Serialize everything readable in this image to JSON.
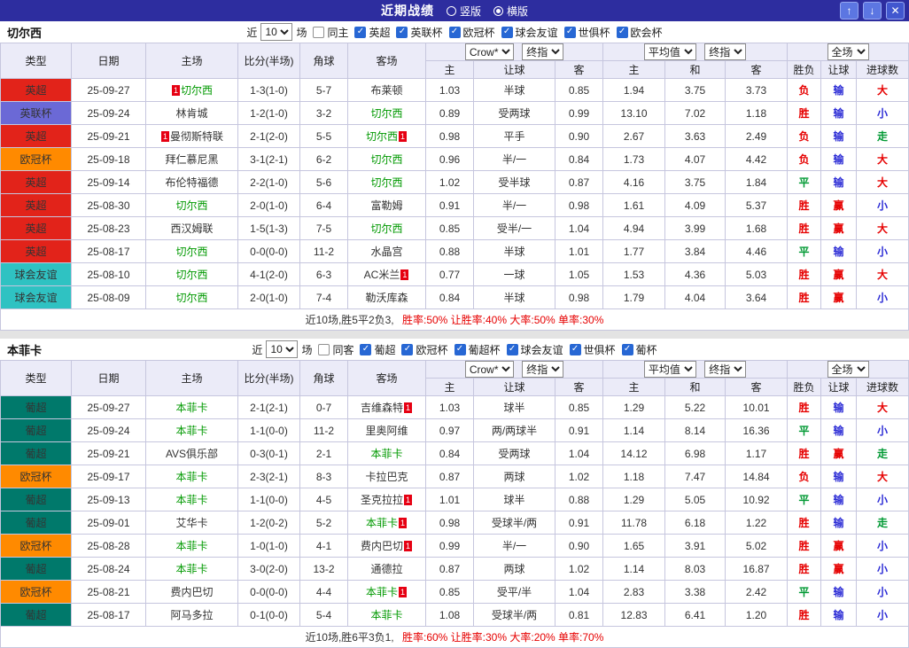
{
  "topbar": {
    "title": "近期战绩",
    "radios": [
      {
        "label": "竖版",
        "selected": false
      },
      {
        "label": "横版",
        "selected": true
      }
    ],
    "buttons": {
      "up": "↑",
      "down": "↓",
      "close": "✕"
    }
  },
  "table_header": {
    "cols": [
      "类型",
      "日期",
      "主场",
      "比分(半场)",
      "角球",
      "客场"
    ],
    "asia_selects": [
      "Crow*",
      "终指"
    ],
    "asia_cols": [
      "主",
      "让球",
      "客"
    ],
    "europe_selects": [
      "平均值",
      "终指"
    ],
    "europe_cols": [
      "主",
      "和",
      "客"
    ],
    "period_select": "全场",
    "result_cols": [
      "胜负",
      "让球",
      "进球数"
    ]
  },
  "league_colors": {
    "英超": "#e2231a",
    "英联杯": "#6b69d6",
    "欧冠杯": "#ff8a00",
    "球会友谊": "#2fc2c2",
    "葡超": "#00796b"
  },
  "result_colors": {
    "red": "#e60000",
    "blue": "#2b2bd5",
    "green": "#009933"
  },
  "colors": {
    "topbar_bg": "#2d2d9f",
    "header_bg": "#ebebf8",
    "focus_team": "#009900",
    "score": "#ff0000",
    "card_badge": "#e60012"
  },
  "sections": [
    {
      "team": "切尔西",
      "filter": {
        "near": "近",
        "count": "10",
        "unit": "场",
        "same": {
          "label": "同主",
          "checked": false
        },
        "leagues": [
          {
            "label": "英超",
            "checked": true
          },
          {
            "label": "英联杯",
            "checked": true
          },
          {
            "label": "欧冠杯",
            "checked": true
          },
          {
            "label": "球会友谊",
            "checked": true
          },
          {
            "label": "世俱杯",
            "checked": true
          },
          {
            "label": "欧会杯",
            "checked": true
          }
        ]
      },
      "rows": [
        {
          "league": "英超",
          "date": "25-09-27",
          "home": "切尔西",
          "home_focus": true,
          "home_card": {
            "pos": "before",
            "count": "1"
          },
          "score": "1-3(1-0)",
          "corners": "5-7",
          "away": "布莱顿",
          "odds": [
            "1.03",
            "半球",
            "0.85"
          ],
          "avg": [
            "1.94",
            "3.75",
            "3.73"
          ],
          "results": [
            [
              "负",
              "red"
            ],
            [
              "输",
              "blue"
            ],
            [
              "大",
              "red"
            ]
          ]
        },
        {
          "league": "英联杯",
          "date": "25-09-24",
          "home": "林肯城",
          "score": "1-2(1-0)",
          "corners": "3-2",
          "away": "切尔西",
          "away_focus": true,
          "odds": [
            "0.89",
            "受两球",
            "0.99"
          ],
          "avg": [
            "13.10",
            "7.02",
            "1.18"
          ],
          "results": [
            [
              "胜",
              "red"
            ],
            [
              "输",
              "blue"
            ],
            [
              "小",
              "blue"
            ]
          ]
        },
        {
          "league": "英超",
          "date": "25-09-21",
          "home": "曼彻斯特联",
          "home_card": {
            "pos": "before",
            "count": "1"
          },
          "score": "2-1(2-0)",
          "corners": "5-5",
          "away": "切尔西",
          "away_focus": true,
          "away_card": {
            "pos": "after",
            "count": "1"
          },
          "odds": [
            "0.98",
            "平手",
            "0.90"
          ],
          "avg": [
            "2.67",
            "3.63",
            "2.49"
          ],
          "results": [
            [
              "负",
              "red"
            ],
            [
              "输",
              "blue"
            ],
            [
              "走",
              "green"
            ]
          ]
        },
        {
          "league": "欧冠杯",
          "date": "25-09-18",
          "home": "拜仁慕尼黑",
          "score": "3-1(2-1)",
          "corners": "6-2",
          "away": "切尔西",
          "away_focus": true,
          "odds": [
            "0.96",
            "半/一",
            "0.84"
          ],
          "avg": [
            "1.73",
            "4.07",
            "4.42"
          ],
          "results": [
            [
              "负",
              "red"
            ],
            [
              "输",
              "blue"
            ],
            [
              "大",
              "red"
            ]
          ]
        },
        {
          "league": "英超",
          "date": "25-09-14",
          "home": "布伦特福德",
          "score": "2-2(1-0)",
          "corners": "5-6",
          "away": "切尔西",
          "away_focus": true,
          "odds": [
            "1.02",
            "受半球",
            "0.87"
          ],
          "avg": [
            "4.16",
            "3.75",
            "1.84"
          ],
          "results": [
            [
              "平",
              "green"
            ],
            [
              "输",
              "blue"
            ],
            [
              "大",
              "red"
            ]
          ]
        },
        {
          "league": "英超",
          "date": "25-08-30",
          "home": "切尔西",
          "home_focus": true,
          "score": "2-0(1-0)",
          "corners": "6-4",
          "away": "富勒姆",
          "odds": [
            "0.91",
            "半/一",
            "0.98"
          ],
          "avg": [
            "1.61",
            "4.09",
            "5.37"
          ],
          "results": [
            [
              "胜",
              "red"
            ],
            [
              "赢",
              "red"
            ],
            [
              "小",
              "blue"
            ]
          ]
        },
        {
          "league": "英超",
          "date": "25-08-23",
          "home": "西汉姆联",
          "score": "1-5(1-3)",
          "corners": "7-5",
          "away": "切尔西",
          "away_focus": true,
          "odds": [
            "0.85",
            "受半/一",
            "1.04"
          ],
          "avg": [
            "4.94",
            "3.99",
            "1.68"
          ],
          "results": [
            [
              "胜",
              "red"
            ],
            [
              "赢",
              "red"
            ],
            [
              "大",
              "red"
            ]
          ]
        },
        {
          "league": "英超",
          "date": "25-08-17",
          "home": "切尔西",
          "home_focus": true,
          "score": "0-0(0-0)",
          "corners": "11-2",
          "away": "水晶宫",
          "odds": [
            "0.88",
            "半球",
            "1.01"
          ],
          "avg": [
            "1.77",
            "3.84",
            "4.46"
          ],
          "results": [
            [
              "平",
              "green"
            ],
            [
              "输",
              "blue"
            ],
            [
              "小",
              "blue"
            ]
          ]
        },
        {
          "league": "球会友谊",
          "date": "25-08-10",
          "home": "切尔西",
          "home_focus": true,
          "score": "4-1(2-0)",
          "corners": "6-3",
          "away": "AC米兰",
          "away_card": {
            "pos": "after",
            "count": "1"
          },
          "odds": [
            "0.77",
            "一球",
            "1.05"
          ],
          "avg": [
            "1.53",
            "4.36",
            "5.03"
          ],
          "results": [
            [
              "胜",
              "red"
            ],
            [
              "赢",
              "red"
            ],
            [
              "大",
              "red"
            ]
          ]
        },
        {
          "league": "球会友谊",
          "date": "25-08-09",
          "home": "切尔西",
          "home_focus": true,
          "score": "2-0(1-0)",
          "corners": "7-4",
          "away": "勒沃库森",
          "odds": [
            "0.84",
            "半球",
            "0.98"
          ],
          "avg": [
            "1.79",
            "4.04",
            "3.64"
          ],
          "results": [
            [
              "胜",
              "red"
            ],
            [
              "赢",
              "red"
            ],
            [
              "小",
              "blue"
            ]
          ]
        }
      ],
      "summary": {
        "record": "近10场,胜5平2负3,",
        "rates": "胜率:50%  让胜率:40%  大率:50%  单率:30%"
      }
    },
    {
      "team": "本菲卡",
      "filter": {
        "near": "近",
        "count": "10",
        "unit": "场",
        "same": {
          "label": "同客",
          "checked": false
        },
        "leagues": [
          {
            "label": "葡超",
            "checked": true
          },
          {
            "label": "欧冠杯",
            "checked": true
          },
          {
            "label": "葡超杯",
            "checked": true
          },
          {
            "label": "球会友谊",
            "checked": true
          },
          {
            "label": "世俱杯",
            "checked": true
          },
          {
            "label": "葡杯",
            "checked": true
          }
        ]
      },
      "rows": [
        {
          "league": "葡超",
          "date": "25-09-27",
          "home": "本菲卡",
          "home_focus": true,
          "score": "2-1(2-1)",
          "corners": "0-7",
          "away": "吉维森特",
          "away_card": {
            "pos": "after",
            "count": "1"
          },
          "odds": [
            "1.03",
            "球半",
            "0.85"
          ],
          "avg": [
            "1.29",
            "5.22",
            "10.01"
          ],
          "results": [
            [
              "胜",
              "red"
            ],
            [
              "输",
              "blue"
            ],
            [
              "大",
              "red"
            ]
          ]
        },
        {
          "league": "葡超",
          "date": "25-09-24",
          "home": "本菲卡",
          "home_focus": true,
          "score": "1-1(0-0)",
          "corners": "11-2",
          "away": "里奥阿维",
          "odds": [
            "0.97",
            "两/两球半",
            "0.91"
          ],
          "avg": [
            "1.14",
            "8.14",
            "16.36"
          ],
          "results": [
            [
              "平",
              "green"
            ],
            [
              "输",
              "blue"
            ],
            [
              "小",
              "blue"
            ]
          ]
        },
        {
          "league": "葡超",
          "date": "25-09-21",
          "home": "AVS俱乐部",
          "score": "0-3(0-1)",
          "corners": "2-1",
          "away": "本菲卡",
          "away_focus": true,
          "odds": [
            "0.84",
            "受两球",
            "1.04"
          ],
          "avg": [
            "14.12",
            "6.98",
            "1.17"
          ],
          "results": [
            [
              "胜",
              "red"
            ],
            [
              "赢",
              "red"
            ],
            [
              "走",
              "green"
            ]
          ]
        },
        {
          "league": "欧冠杯",
          "date": "25-09-17",
          "home": "本菲卡",
          "home_focus": true,
          "score": "2-3(2-1)",
          "corners": "8-3",
          "away": "卡拉巴克",
          "odds": [
            "0.87",
            "两球",
            "1.02"
          ],
          "avg": [
            "1.18",
            "7.47",
            "14.84"
          ],
          "results": [
            [
              "负",
              "red"
            ],
            [
              "输",
              "blue"
            ],
            [
              "大",
              "red"
            ]
          ]
        },
        {
          "league": "葡超",
          "date": "25-09-13",
          "home": "本菲卡",
          "home_focus": true,
          "score": "1-1(0-0)",
          "corners": "4-5",
          "away": "圣克拉拉",
          "away_card": {
            "pos": "after",
            "count": "1"
          },
          "odds": [
            "1.01",
            "球半",
            "0.88"
          ],
          "avg": [
            "1.29",
            "5.05",
            "10.92"
          ],
          "results": [
            [
              "平",
              "green"
            ],
            [
              "输",
              "blue"
            ],
            [
              "小",
              "blue"
            ]
          ]
        },
        {
          "league": "葡超",
          "date": "25-09-01",
          "home": "艾华卡",
          "score": "1-2(0-2)",
          "corners": "5-2",
          "away": "本菲卡",
          "away_focus": true,
          "away_card": {
            "pos": "after",
            "count": "1"
          },
          "odds": [
            "0.98",
            "受球半/两",
            "0.91"
          ],
          "avg": [
            "11.78",
            "6.18",
            "1.22"
          ],
          "results": [
            [
              "胜",
              "red"
            ],
            [
              "输",
              "blue"
            ],
            [
              "走",
              "green"
            ]
          ]
        },
        {
          "league": "欧冠杯",
          "date": "25-08-28",
          "home": "本菲卡",
          "home_focus": true,
          "score": "1-0(1-0)",
          "corners": "4-1",
          "away": "费内巴切",
          "away_card": {
            "pos": "after",
            "count": "1"
          },
          "odds": [
            "0.99",
            "半/一",
            "0.90"
          ],
          "avg": [
            "1.65",
            "3.91",
            "5.02"
          ],
          "results": [
            [
              "胜",
              "red"
            ],
            [
              "赢",
              "red"
            ],
            [
              "小",
              "blue"
            ]
          ]
        },
        {
          "league": "葡超",
          "date": "25-08-24",
          "home": "本菲卡",
          "home_focus": true,
          "score": "3-0(2-0)",
          "corners": "13-2",
          "away": "通德拉",
          "odds": [
            "0.87",
            "两球",
            "1.02"
          ],
          "avg": [
            "1.14",
            "8.03",
            "16.87"
          ],
          "results": [
            [
              "胜",
              "red"
            ],
            [
              "赢",
              "red"
            ],
            [
              "小",
              "blue"
            ]
          ]
        },
        {
          "league": "欧冠杯",
          "date": "25-08-21",
          "home": "费内巴切",
          "score": "0-0(0-0)",
          "corners": "4-4",
          "away": "本菲卡",
          "away_focus": true,
          "away_card": {
            "pos": "after",
            "count": "1"
          },
          "odds": [
            "0.85",
            "受平/半",
            "1.04"
          ],
          "avg": [
            "2.83",
            "3.38",
            "2.42"
          ],
          "results": [
            [
              "平",
              "green"
            ],
            [
              "输",
              "blue"
            ],
            [
              "小",
              "blue"
            ]
          ]
        },
        {
          "league": "葡超",
          "date": "25-08-17",
          "home": "阿马多拉",
          "score": "0-1(0-0)",
          "corners": "5-4",
          "away": "本菲卡",
          "away_focus": true,
          "odds": [
            "1.08",
            "受球半/两",
            "0.81"
          ],
          "avg": [
            "12.83",
            "6.41",
            "1.20"
          ],
          "results": [
            [
              "胜",
              "red"
            ],
            [
              "输",
              "blue"
            ],
            [
              "小",
              "blue"
            ]
          ]
        }
      ],
      "summary": {
        "record": "近10场,胜6平3负1,",
        "rates": "胜率:60%  让胜率:30%  大率:20%  单率:70%"
      }
    }
  ]
}
